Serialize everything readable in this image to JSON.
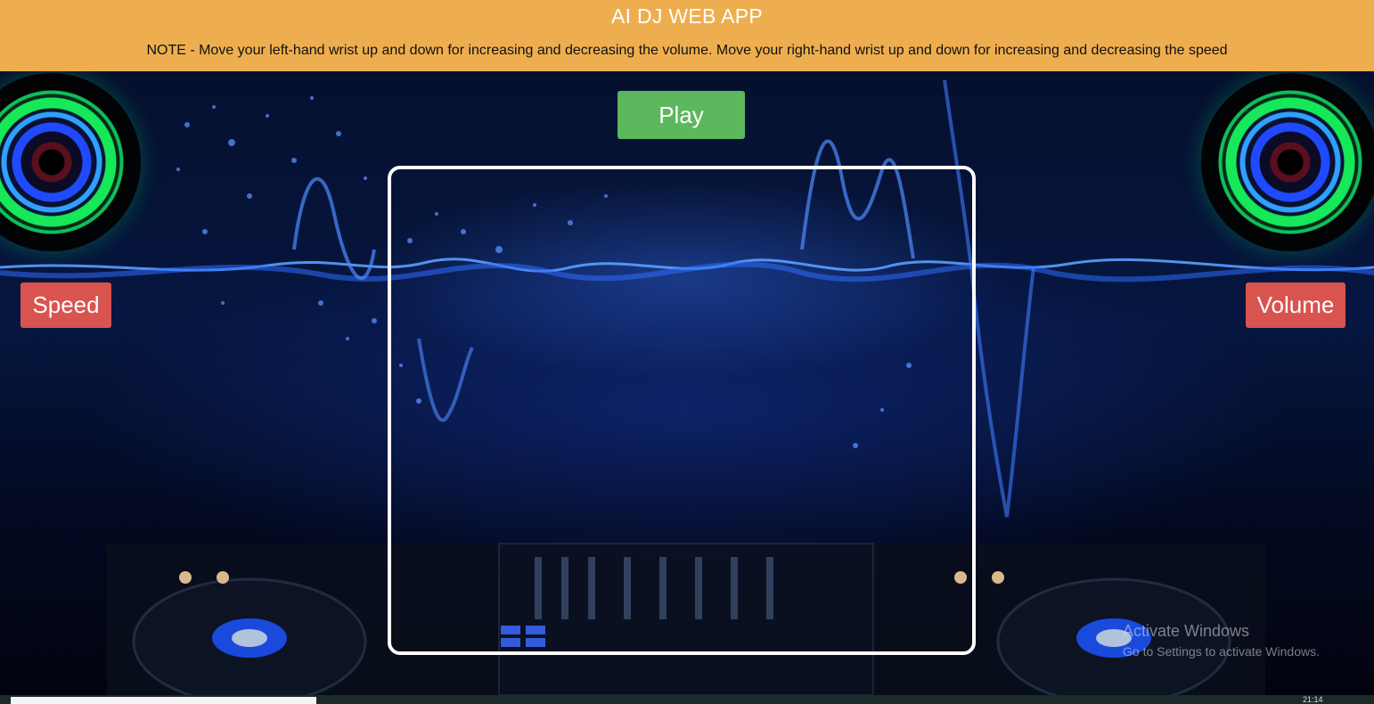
{
  "header": {
    "title": "AI DJ WEB APP",
    "note": "NOTE - Move your left-hand wrist up and down for increasing and decreasing the volume. Move your right-hand wrist up and down for increasing and decreasing the speed"
  },
  "controls": {
    "play_label": "Play",
    "speed_label": "Speed",
    "volume_label": "Volume"
  },
  "watermark": {
    "line1": "Activate Windows",
    "line2": "Go to Settings to activate Windows."
  },
  "taskbar": {
    "clock": "21:14"
  },
  "colors": {
    "header_bg": "#eeae4f",
    "play_button": "#5cb85c",
    "side_buttons": "#d9534f",
    "canvas_border": "#ffffff"
  },
  "icons": {
    "left_speaker": "speaker-icon",
    "right_speaker": "speaker-icon"
  }
}
